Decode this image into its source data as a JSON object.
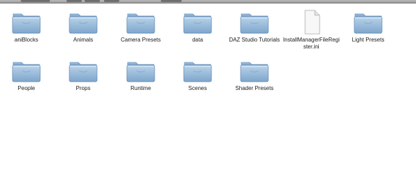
{
  "window": {
    "toolbar_color": "#a8a8a8",
    "folder_color": "#8fb4d6"
  },
  "files": [
    {
      "name": "aniBlocks",
      "kind": "folder",
      "icon": "folder-icon"
    },
    {
      "name": "Animals",
      "kind": "folder",
      "icon": "folder-icon"
    },
    {
      "name": "Camera Presets",
      "kind": "folder",
      "icon": "folder-icon"
    },
    {
      "name": "data",
      "kind": "folder",
      "icon": "folder-icon"
    },
    {
      "name": "DAZ Studio Tutorials",
      "kind": "folder",
      "icon": "folder-icon"
    },
    {
      "name": "InstallManagerFileRegister.ini",
      "kind": "file",
      "icon": "document-icon"
    },
    {
      "name": "Light Presets",
      "kind": "folder",
      "icon": "folder-icon"
    },
    {
      "name": "People",
      "kind": "folder",
      "icon": "folder-icon"
    },
    {
      "name": "Props",
      "kind": "folder",
      "icon": "folder-icon"
    },
    {
      "name": "Runtime",
      "kind": "folder",
      "icon": "folder-icon"
    },
    {
      "name": "Scenes",
      "kind": "folder",
      "icon": "folder-icon"
    },
    {
      "name": "Shader Presets",
      "kind": "folder",
      "icon": "folder-icon"
    }
  ]
}
